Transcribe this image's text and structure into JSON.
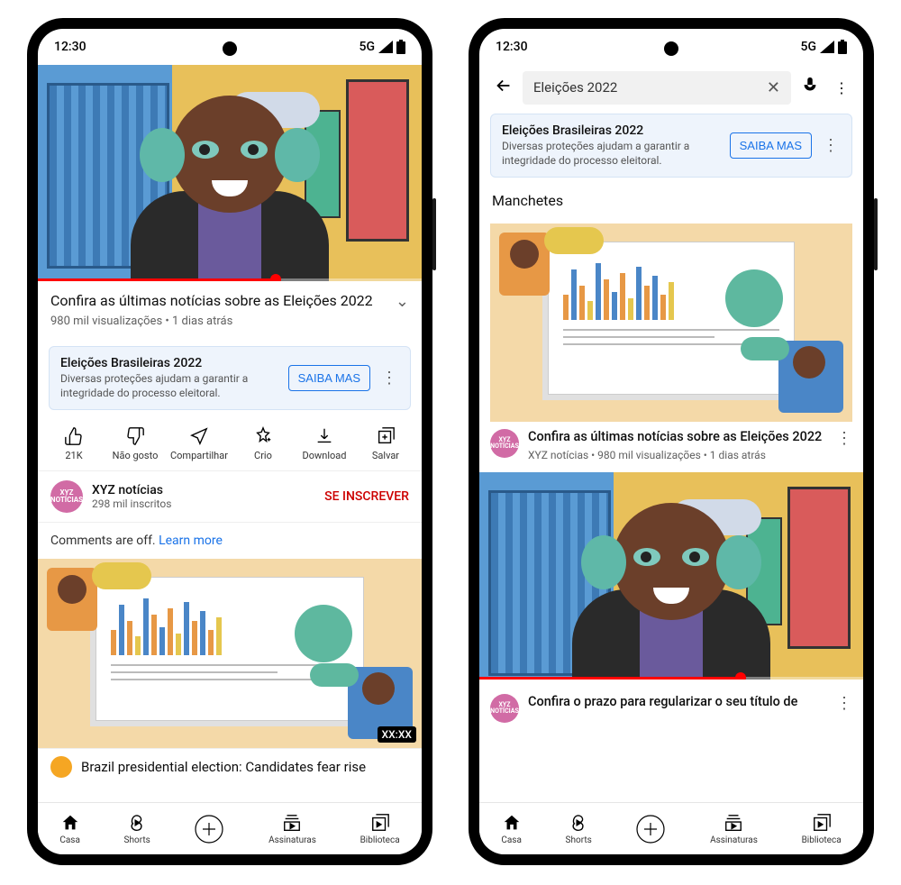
{
  "status_bar": {
    "time": "12:30",
    "network": "5G"
  },
  "phone1": {
    "video": {
      "title": "Confira as últimas notícias sobre as Eleições 2022",
      "meta": "980 mil visualizações • 1 dias atrás"
    },
    "info_banner": {
      "title": "Eleições Brasileiras 2022",
      "desc": "Diversas proteções ajudam a garantir a integridade do processo eleitoral.",
      "button": "SAIBA MAS"
    },
    "actions": {
      "like": "21K",
      "dislike": "Não gosto",
      "share": "Compartilhar",
      "create": "Crio",
      "download": "Download",
      "save": "Salvar"
    },
    "channel": {
      "avatar_text": "XYZ NOTÍCIAS",
      "name": "XYZ notícias",
      "subs": "298 mil inscritos",
      "subscribe": "SE INSCREVER"
    },
    "comments": {
      "text": "Comments are off. ",
      "link": "Learn more"
    },
    "next_thumb_duration": "XX:XX",
    "next_partial_title": "Brazil presidential election: Candidates fear rise"
  },
  "phone2": {
    "search_query": "Eleições 2022",
    "info_banner": {
      "title": "Eleições Brasileiras 2022",
      "desc": "Diversas proteções ajudam a garantir a integridade do processo eleitoral.",
      "button": "SAIBA MAS"
    },
    "section": "Manchetes",
    "result1": {
      "title": "Confira as últimas notícias sobre as Eleições 2022",
      "meta": "XYZ notícias • 980 mil visualizações • 1 dias atrás"
    },
    "result2": {
      "title": "Confira o prazo para regularizar o seu título de"
    },
    "channel_avatar_text": "XYZ NOTÍCIAS"
  },
  "nav": {
    "home": "Casa",
    "shorts": "Shorts",
    "subs": "Assinaturas",
    "library": "Biblioteca"
  }
}
